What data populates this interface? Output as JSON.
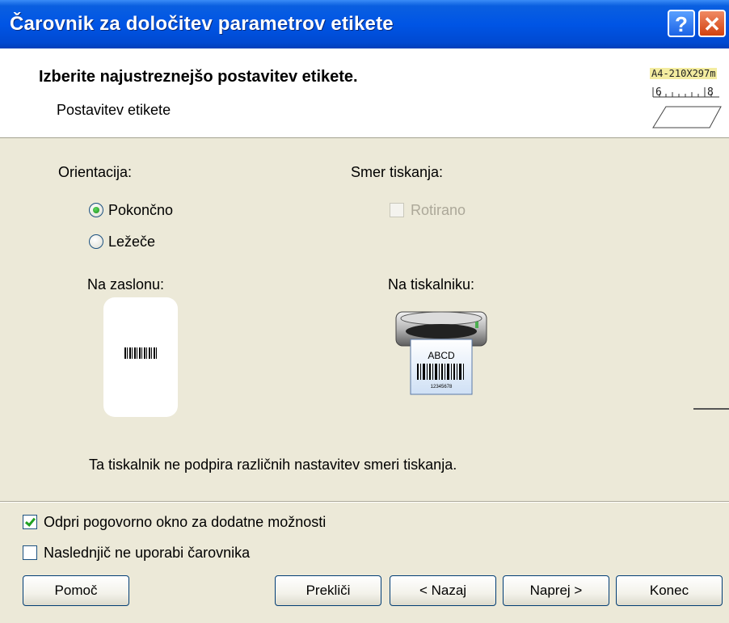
{
  "window": {
    "title": "Čarovnik za določitev parametrov etikete",
    "help_glyph": "?",
    "close_glyph": "✕"
  },
  "header": {
    "title": "Izberite najustreznejšo postavitev etikete.",
    "subtitle": "Postavitev etikete",
    "paper_size": "A4-210X297m",
    "ruler_marks": [
      "6",
      "8"
    ]
  },
  "orientation": {
    "label": "Orientacija:",
    "options": [
      {
        "label": "Pokončno",
        "selected": true
      },
      {
        "label": "Ležeče",
        "selected": false
      }
    ]
  },
  "print_direction": {
    "label": "Smer tiskanja:",
    "rotated_label": "Rotirano",
    "rotated_checked": false,
    "enabled": false
  },
  "preview": {
    "screen_label": "Na zaslonu:",
    "printer_label": "Na tiskalniku:",
    "label_text": "ABCD",
    "label_code": "12345678"
  },
  "notice": "Ta tiskalnik ne podpira različnih nastavitev smeri tiskanja.",
  "options": {
    "open_dialog_label": "Odpri pogovorno okno za dodatne možnosti",
    "open_dialog_checked": true,
    "skip_wizard_label": "Naslednjič ne uporabi čarovnika",
    "skip_wizard_checked": false
  },
  "buttons": {
    "help": "Pomoč",
    "cancel": "Prekliči",
    "back": "< Nazaj",
    "next": "Naprej >",
    "finish": "Konec"
  },
  "colors": {
    "titlebar": "#0055e5",
    "dialog_bg": "#ece9d8",
    "check_green": "#21a121"
  }
}
